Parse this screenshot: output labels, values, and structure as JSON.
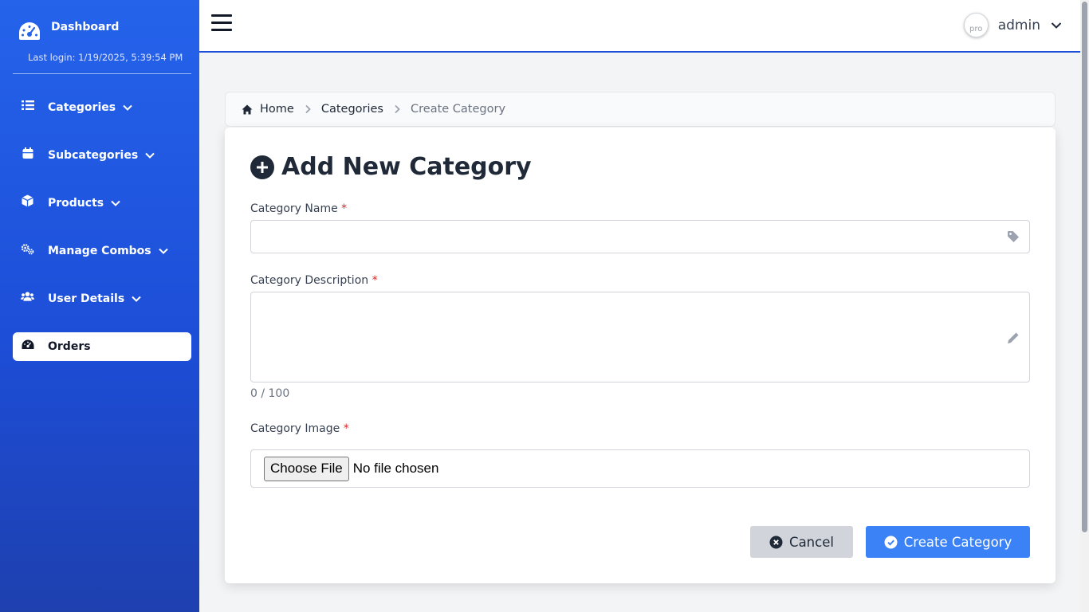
{
  "sidebar": {
    "brand": {
      "title": "Dashboard",
      "icon": "gauge-icon"
    },
    "last_login": "Last login: 1/19/2025, 5:39:54 PM",
    "items": [
      {
        "label": "Categories",
        "icon": "list-icon",
        "has_dropdown": true
      },
      {
        "label": "Subcategories",
        "icon": "calendar-icon",
        "has_dropdown": true
      },
      {
        "label": "Products",
        "icon": "box-icon",
        "has_dropdown": true
      },
      {
        "label": "Manage Combos",
        "icon": "cogs-icon",
        "has_dropdown": true
      },
      {
        "label": "User Details",
        "icon": "users-icon",
        "has_dropdown": true
      },
      {
        "label": "Orders",
        "icon": "gauge-icon",
        "active": true
      }
    ]
  },
  "topbar": {
    "username": "admin",
    "avatar_alt": "pro"
  },
  "breadcrumb": {
    "home": "Home",
    "categories": "Categories",
    "current": "Create Category"
  },
  "form": {
    "title": "Add New Category",
    "name_label": "Category Name",
    "name_value": "",
    "description_label": "Category Description",
    "description_value": "",
    "char_count": "0 / 100",
    "image_label": "Category Image",
    "file_button": "Choose File",
    "file_status": "No file chosen",
    "required_marker": "*",
    "cancel_label": "Cancel",
    "submit_label": "Create Category"
  },
  "colors": {
    "sidebar_top": "#2563eb",
    "sidebar_bottom": "#1e40af",
    "primary_button": "#3b82f6",
    "required": "#dc2626"
  }
}
